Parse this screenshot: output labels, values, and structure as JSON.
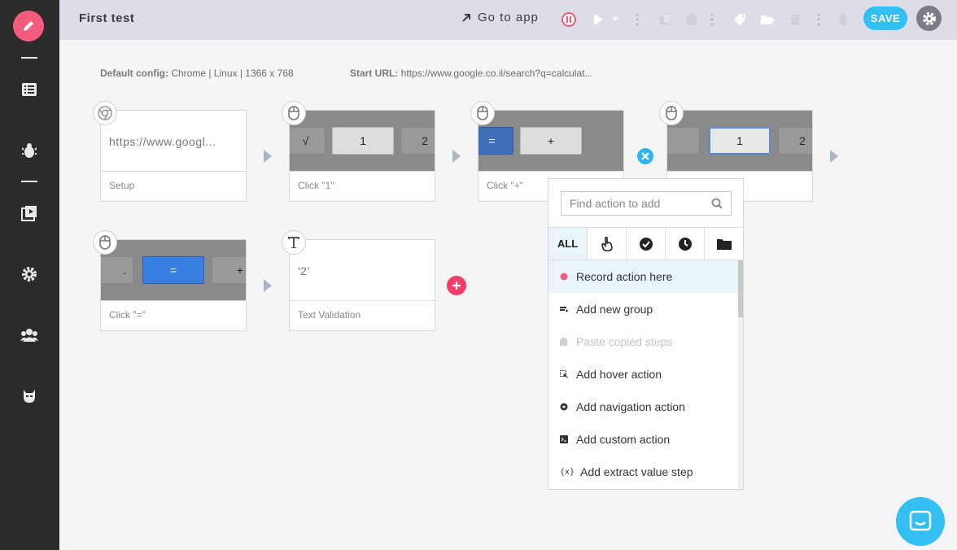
{
  "header": {
    "title": "First test",
    "goto_label": "Go to app",
    "save_label": "SAVE"
  },
  "config": {
    "default_label": "Default config:",
    "default_value": "Chrome | Linux | 1366 x 768",
    "start_label": "Start URL:",
    "start_value": "https://www.google.co.il/search?q=calculat..."
  },
  "steps": [
    {
      "caption": "Setup",
      "content": "https://www.googl...",
      "icon": "chrome-icon"
    },
    {
      "caption": "Click \"1\"",
      "key": "1",
      "icon": "mouse-icon"
    },
    {
      "caption": "Click \"+\"",
      "key": "+",
      "icon": "mouse-icon"
    },
    {
      "caption": "",
      "key": "1",
      "icon": "mouse-icon"
    },
    {
      "caption": "Click \"=\"",
      "key": "=",
      "icon": "mouse-icon"
    },
    {
      "caption": "Text Validation",
      "content": "'2'",
      "icon": "text-icon"
    }
  ],
  "thumb_labels": {
    "sqrt": "√",
    "two": "2",
    "eq": "=",
    "plus": "+",
    "dot": "."
  },
  "add_panel": {
    "search_placeholder": "Find action to add",
    "tabs": [
      {
        "label": "ALL"
      }
    ],
    "items": [
      {
        "label": "Record action here",
        "icon": "record-icon"
      },
      {
        "label": "Add new group",
        "icon": "group-icon"
      },
      {
        "label": "Paste copied steps",
        "icon": "paste-icon"
      },
      {
        "label": "Add hover action",
        "icon": "hover-icon"
      },
      {
        "label": "Add navigation action",
        "icon": "navigation-icon"
      },
      {
        "label": "Add custom action",
        "icon": "custom-icon"
      },
      {
        "label": "Add extract value step",
        "icon": "extract-icon",
        "prefix": "{x}"
      }
    ]
  },
  "colors": {
    "accent": "#33bff2",
    "brand": "#f25c7c",
    "sidebar": "#2b2b2b",
    "record": "#f25c7c"
  }
}
